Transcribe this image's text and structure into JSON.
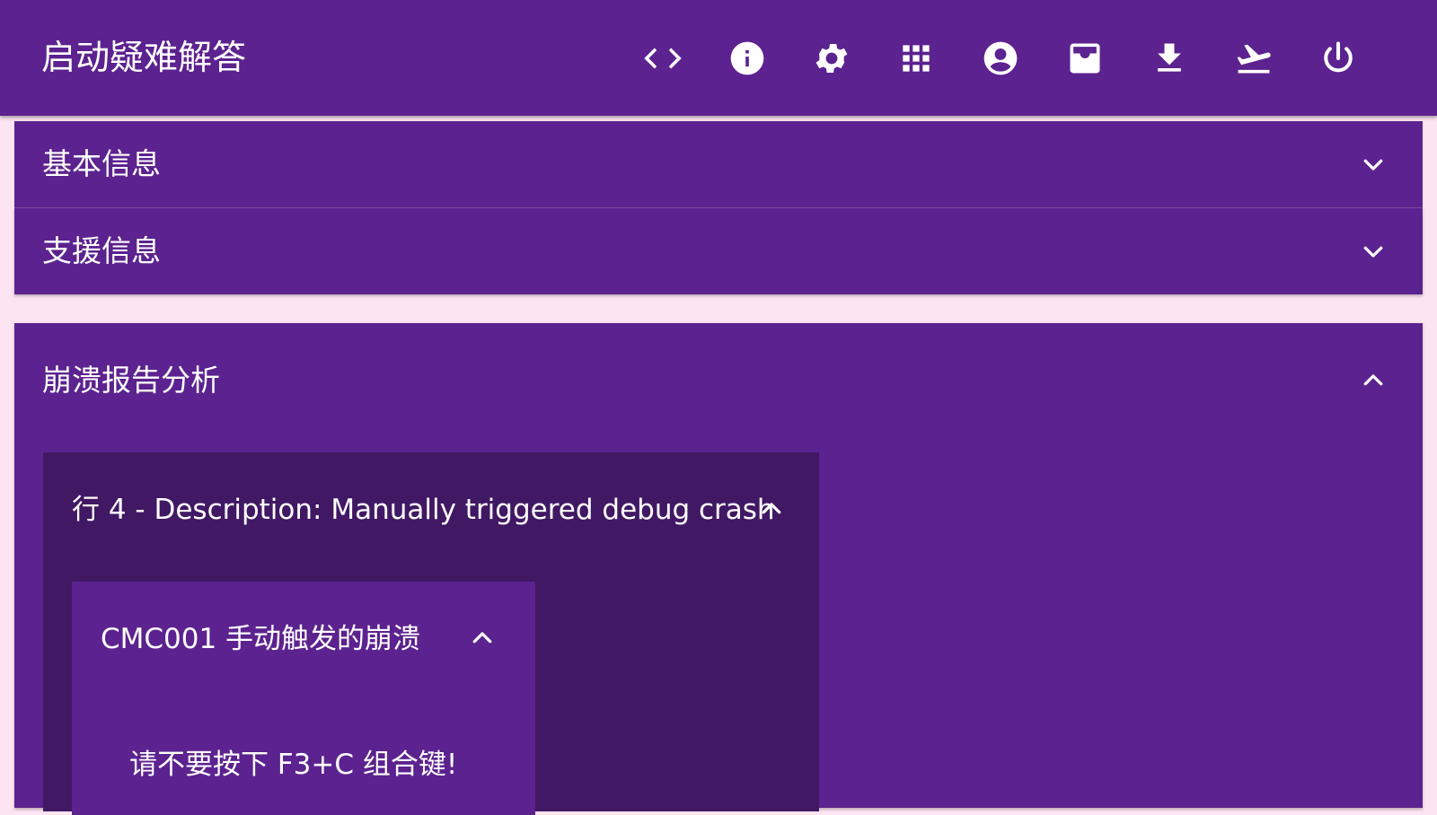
{
  "app": {
    "title": "启动疑难解答"
  },
  "toolbar": {
    "items": [
      {
        "name": "code-icon",
        "label": "代码"
      },
      {
        "name": "info-icon",
        "label": "信息"
      },
      {
        "name": "gear-icon",
        "label": "设置"
      },
      {
        "name": "apps-grid-icon",
        "label": "应用"
      },
      {
        "name": "account-icon",
        "label": "账户"
      },
      {
        "name": "inbox-icon",
        "label": "收件箱"
      },
      {
        "name": "download-icon",
        "label": "下载"
      },
      {
        "name": "flight-takeoff-icon",
        "label": "起飞"
      },
      {
        "name": "power-icon",
        "label": "电源"
      }
    ]
  },
  "sections": {
    "basic_info": {
      "label": "基本信息",
      "expanded": false
    },
    "support_info": {
      "label": "支援信息",
      "expanded": false
    },
    "crash_analysis": {
      "label": "崩溃报告分析",
      "expanded": true
    }
  },
  "crash_row": {
    "label": "行 4 - Description: Manually triggered debug crash",
    "expanded": true
  },
  "crash_code": {
    "label": "CMC001 手动触发的崩溃",
    "expanded": true,
    "body": "请不要按下 F3+C 组合键!"
  },
  "colors": {
    "primary": "#5C228F",
    "primary_dark": "#411864",
    "background": "#FDE4F2",
    "text": "#FFFFFF"
  }
}
